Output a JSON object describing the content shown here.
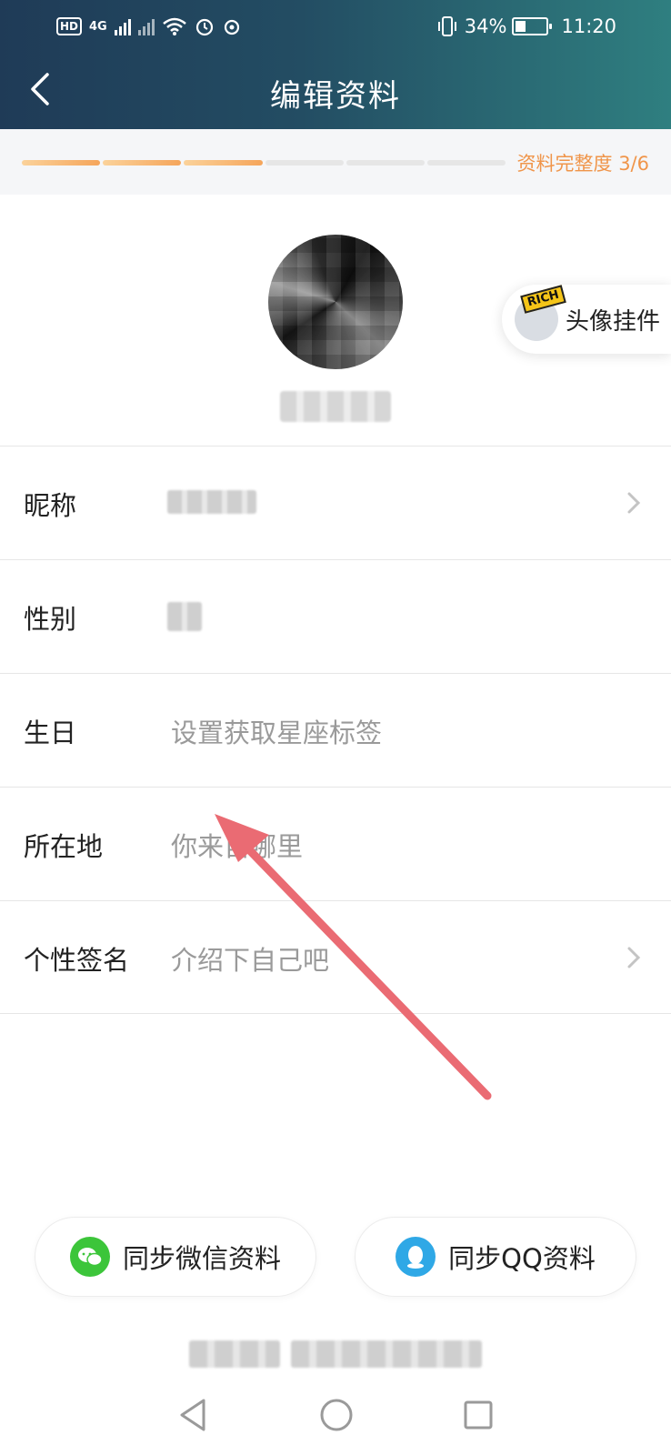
{
  "status_bar": {
    "network": "4G",
    "battery_percent": "34%",
    "battery_level": 0.34,
    "time": "11:20"
  },
  "header": {
    "title": "编辑资料"
  },
  "progress": {
    "completion_text": "资料完整度 3/6",
    "completed": 3,
    "total": 6
  },
  "pendant": {
    "badge": "RICH",
    "label": "头像挂件"
  },
  "form": {
    "rows": [
      {
        "label": "昵称",
        "value": ""
      },
      {
        "label": "性别",
        "value": ""
      },
      {
        "label": "生日",
        "value": "设置获取星座标签"
      },
      {
        "label": "所在地",
        "value": "你来自哪里"
      },
      {
        "label": "个性签名",
        "value": "介绍下自己吧"
      }
    ]
  },
  "sync": {
    "wechat_label": "同步微信资料",
    "qq_label": "同步QQ资料"
  },
  "colors": {
    "header_start": "#1f3b57",
    "header_end": "#2f7f80",
    "progress_accent": "#f5a55b",
    "wechat_green": "#3cc53a",
    "qq_blue": "#2fa8e6",
    "annotation_arrow": "#ea6b73"
  },
  "icons": {
    "back": "chevron-left-icon",
    "chevron": "chevron-right-icon",
    "wechat": "wechat-icon",
    "qq": "qq-penguin-icon",
    "nav_back": "triangle-back-icon",
    "nav_home": "circle-home-icon",
    "nav_recent": "square-recent-icon"
  }
}
